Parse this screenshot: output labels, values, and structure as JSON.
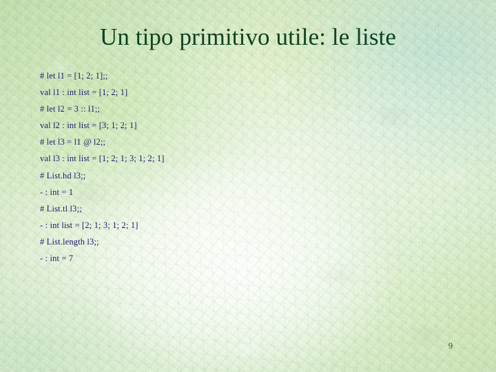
{
  "slide": {
    "title": "Un tipo primitivo utile: le liste",
    "page_number": "9",
    "title_color": "#0c4322",
    "body_color": "#1b1b70",
    "page_number_color": "#2f5a38",
    "background_color": "#d8ecc8",
    "background_texture": "crumpled-green-parchment"
  },
  "code": {
    "lines": [
      "# let l1 = [1; 2; 1];;",
      "val l1 : int list = [1; 2; 1]",
      "# let l2 = 3 :: l1;;",
      "val l2 : int list = [3; 1; 2; 1]",
      "# let l3 = l1 @ l2;;",
      "val l3 : int list = [1; 2; 1; 3; 1; 2; 1]",
      "# List.hd l3;;",
      "- : int = 1",
      "# List.tl l3;;",
      "- : int list = [2; 1; 3; 1; 2; 1]",
      "# List.length l3;;",
      "- : int = 7"
    ]
  }
}
